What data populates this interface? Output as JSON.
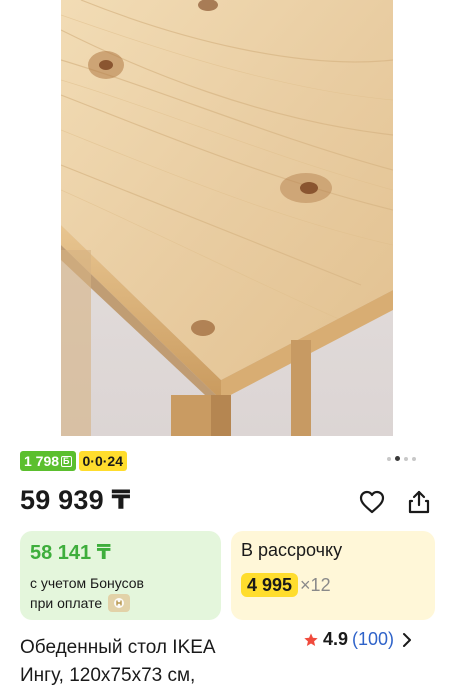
{
  "gallery": {
    "dots": 4,
    "active_dot": 2,
    "image_alt_icon": "product-photo"
  },
  "badges": {
    "bonus_amount": "1 798",
    "bonus_currency": "Б",
    "installment": "0·0·24"
  },
  "price": {
    "main": "59 939 ₸"
  },
  "actions": {
    "favorite_icon": "heart-icon",
    "share_icon": "share-icon"
  },
  "bonus_card": {
    "price": "58 141 ₸",
    "line1": "с учетом Бонусов",
    "line2": "при оплате"
  },
  "credit_card": {
    "title": "В рассрочку",
    "amount": "4 995",
    "multiplier": "×12"
  },
  "product": {
    "title_line1": "Обеденный стол IKEA",
    "title_line2": "Ингу, 120x75x73 см,"
  },
  "rating": {
    "score": "4.9",
    "count": "(100)"
  },
  "colors": {
    "green": "#5bbf2e",
    "yellow": "#ffdd2d",
    "star": "#f04a3c",
    "link_blue": "#2f63c9"
  }
}
